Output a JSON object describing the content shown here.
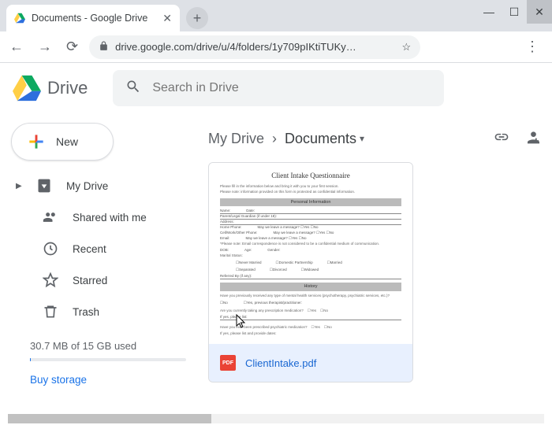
{
  "browser": {
    "tab_title": "Documents - Google Drive",
    "url_display": "drive.google.com/drive/u/4/folders/1y709pIKtiTUKy…"
  },
  "header": {
    "product": "Drive",
    "search_placeholder": "Search in Drive"
  },
  "sidebar": {
    "new_label": "New",
    "items": [
      {
        "label": "My Drive"
      },
      {
        "label": "Shared with me"
      },
      {
        "label": "Recent"
      },
      {
        "label": "Starred"
      },
      {
        "label": "Trash"
      }
    ],
    "storage_text": "30.7 MB of 15 GB used",
    "buy_label": "Buy storage"
  },
  "breadcrumb": {
    "root": "My Drive",
    "current": "Documents"
  },
  "file": {
    "name": "ClientIntake.pdf",
    "badge": "PDF",
    "preview": {
      "title": "Client Intake Questionnaire",
      "section1": "Personal Information",
      "section2": "History"
    }
  }
}
